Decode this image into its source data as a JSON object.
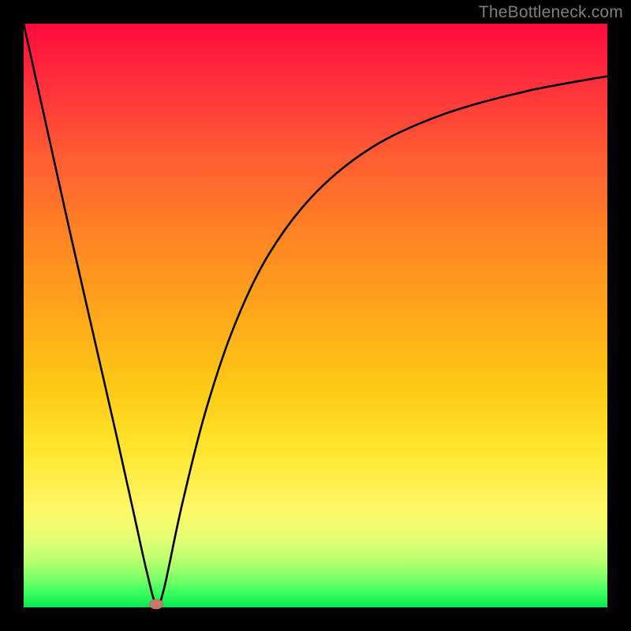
{
  "attribution": "TheBottleneck.com",
  "chart_data": {
    "type": "line",
    "title": "",
    "xlabel": "",
    "ylabel": "",
    "xlim": [
      0,
      100
    ],
    "ylim": [
      0,
      100
    ],
    "grid": false,
    "legend": false,
    "annotations": [
      "marker at approximate minimum near x≈23"
    ],
    "series": [
      {
        "name": "bottleneck-curve",
        "x": [
          0,
          4,
          8,
          12,
          16,
          19,
          21,
          22.7,
          24,
          27,
          31,
          36,
          42,
          50,
          60,
          72,
          86,
          100
        ],
        "y": [
          100,
          82,
          64,
          46.5,
          29,
          15.5,
          6.5,
          0.5,
          3,
          17,
          33,
          48,
          60.5,
          71,
          79,
          84.5,
          88.4,
          91
        ]
      }
    ],
    "marker": {
      "x": 22.7,
      "y": 0.5,
      "color": "#c47a6b"
    },
    "gradient_colors": {
      "top": "#ff0a3d",
      "mid": "#ffe32a",
      "bottom": "#06e84f"
    }
  }
}
